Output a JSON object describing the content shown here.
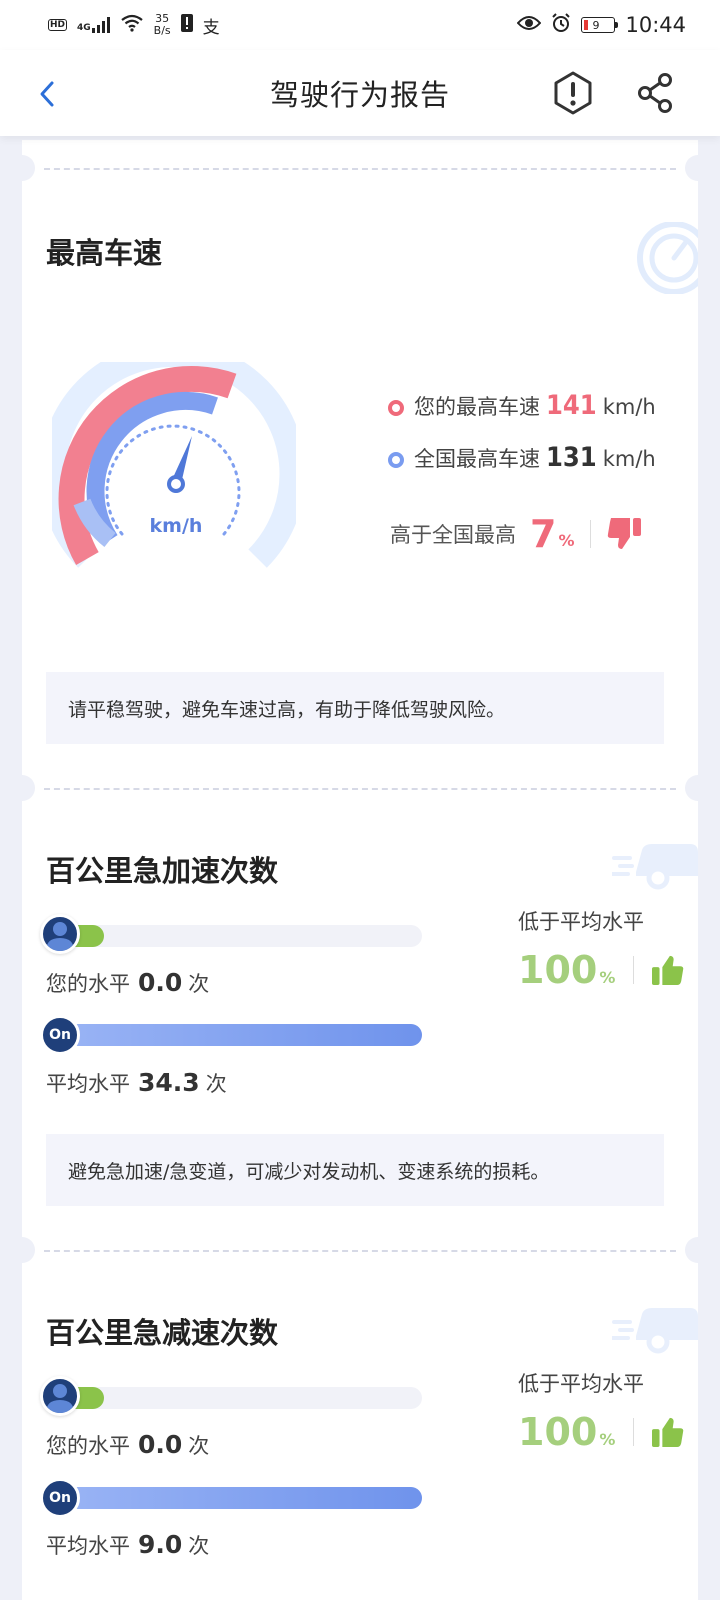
{
  "statusbar": {
    "hd": "HD",
    "signal": "4G",
    "speed_value": "35",
    "speed_unit": "B/s",
    "pay_glyph": "支",
    "battery": "9",
    "time": "10:44"
  },
  "header": {
    "title": "驾驶行为报告",
    "icons": [
      "back-chevron-icon",
      "warning-icon",
      "share-icon"
    ]
  },
  "max_speed": {
    "title": "最高车速",
    "gauge_unit": "km/h",
    "yours_label": "您的最高车速",
    "yours_value": "141",
    "national_label": "全国最高车速",
    "national_value": "131",
    "unit": "km/h",
    "higher_label": "高于全国最高",
    "higher_pct": "7",
    "pct_sign": "%",
    "tip": "请平稳驾驶，避免车速过高，有助于降低驾驶风险。",
    "colors": {
      "yours": "#ef6a7a",
      "national": "#7a9cf0"
    }
  },
  "hard_accel": {
    "title": "百公里急加速次数",
    "my_label": "您的水平",
    "my_value": "0.0",
    "avg_label": "平均水平",
    "avg_value": "34.3",
    "unit": "次",
    "avg_badge": "On",
    "cmp_label": "低于平均水平",
    "cmp_pct": "100",
    "pct_sign": "%",
    "my_ratio": 0.0,
    "tip": "避免急加速/急变道，可减少对发动机、变速系统的损耗。"
  },
  "hard_brake": {
    "title": "百公里急减速次数",
    "my_label": "您的水平",
    "my_value": "0.0",
    "avg_label": "平均水平",
    "avg_value": "9.0",
    "unit": "次",
    "avg_badge": "On",
    "cmp_label": "低于平均水平",
    "cmp_pct": "100",
    "pct_sign": "%",
    "my_ratio": 0.0
  }
}
